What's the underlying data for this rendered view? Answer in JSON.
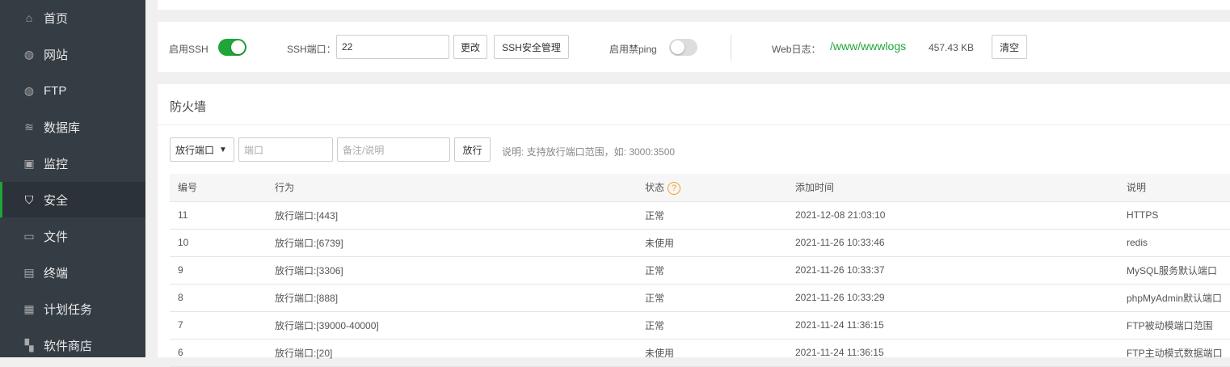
{
  "sidebar": {
    "items": [
      {
        "label": "首页",
        "icon": "home-icon",
        "glyph": "⌂"
      },
      {
        "label": "网站",
        "icon": "globe-icon",
        "glyph": "◍"
      },
      {
        "label": "FTP",
        "icon": "ftp-icon",
        "glyph": "◍"
      },
      {
        "label": "数据库",
        "icon": "database-icon",
        "glyph": "≋"
      },
      {
        "label": "监控",
        "icon": "monitor-icon",
        "glyph": "▣"
      },
      {
        "label": "安全",
        "icon": "shield-icon",
        "glyph": "⛉",
        "active": true
      },
      {
        "label": "文件",
        "icon": "folder-icon",
        "glyph": "▭"
      },
      {
        "label": "终端",
        "icon": "terminal-icon",
        "glyph": "▤"
      },
      {
        "label": "计划任务",
        "icon": "calendar-icon",
        "glyph": "▦"
      },
      {
        "label": "软件商店",
        "icon": "apps-icon",
        "glyph": "▚"
      }
    ]
  },
  "settings": {
    "ssh_label": "启用SSH",
    "ssh_enabled": true,
    "port_label": "SSH端口：",
    "port_value": "22",
    "change_btn": "更改",
    "ssh_manage_btn": "SSH安全管理",
    "ping_label": "启用禁ping",
    "ping_enabled": false,
    "weblog_label": "Web日志：",
    "weblog_path": "/www/wwwlogs",
    "weblog_size": "457.43 KB",
    "clear_btn": "清空"
  },
  "firewall": {
    "title": "防火墙",
    "select_value": "放行端口",
    "port_placeholder": "端口",
    "note_placeholder": "备注/说明",
    "allow_btn": "放行",
    "hint": "说明: 支持放行端口范围，如: 3000:3500",
    "columns": [
      "编号",
      "行为",
      "状态",
      "添加时间",
      "说明"
    ],
    "rows": [
      [
        "11",
        "放行端口:[443]",
        "正常",
        "2021-12-08 21:03:10",
        "HTTPS"
      ],
      [
        "10",
        "放行端口:[6739]",
        "未使用",
        "2021-11-26 10:33:46",
        "redis"
      ],
      [
        "9",
        "放行端口:[3306]",
        "正常",
        "2021-11-26 10:33:37",
        "MySQL服务默认端口"
      ],
      [
        "8",
        "放行端口:[888]",
        "正常",
        "2021-11-26 10:33:29",
        "phpMyAdmin默认端口"
      ],
      [
        "7",
        "放行端口:[39000-40000]",
        "正常",
        "2021-11-24 11:36:15",
        "FTP被动模端口范围"
      ],
      [
        "6",
        "放行端口:[20]",
        "未使用",
        "2021-11-24 11:36:15",
        "FTP主动模式数据端口"
      ]
    ]
  },
  "colors": {
    "accent": "#20a53a",
    "sidebar": "#353d44",
    "link": "#20a53a"
  }
}
